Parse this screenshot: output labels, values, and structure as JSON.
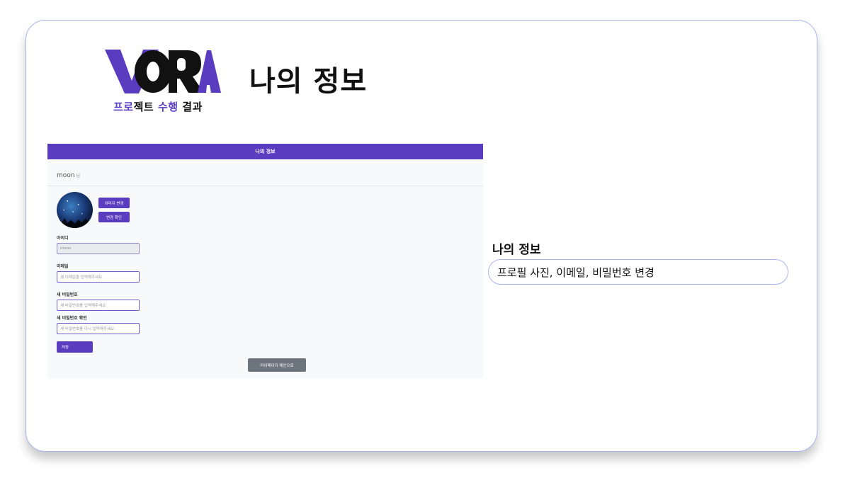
{
  "slide": {
    "logo_word": "VORA",
    "logo_sub": {
      "p1": "프로",
      "b1": "젝트",
      "p2": "수행",
      "b2": "결과"
    },
    "title": "나의 정보"
  },
  "screenshot": {
    "header_title": "나의 정보",
    "username": "moon",
    "honorific": "님",
    "buttons": {
      "change_image": "이미지 변경",
      "confirm_change": "변경 확인",
      "save": "저장",
      "back_to_mypage": "마이페이지 메인으로"
    },
    "fields": {
      "id": {
        "label": "아이디",
        "value": "moon"
      },
      "email": {
        "label": "이메일",
        "placeholder": "새 이메일을 입력해주세요"
      },
      "new_password": {
        "label": "새 비밀번호",
        "placeholder": "새 비밀번호를 입력해주세요"
      },
      "confirm_password": {
        "label": "새 비밀번호 확인",
        "placeholder": "새 비밀번호를 다시 입력해주세요"
      }
    }
  },
  "description": {
    "title": "나의 정보",
    "text": "프로필 사진, 이메일, 비밀번호 변경"
  },
  "colors": {
    "brand": "#5a3cc0",
    "border": "#a9b4ee",
    "secondary": "#6c757d"
  }
}
